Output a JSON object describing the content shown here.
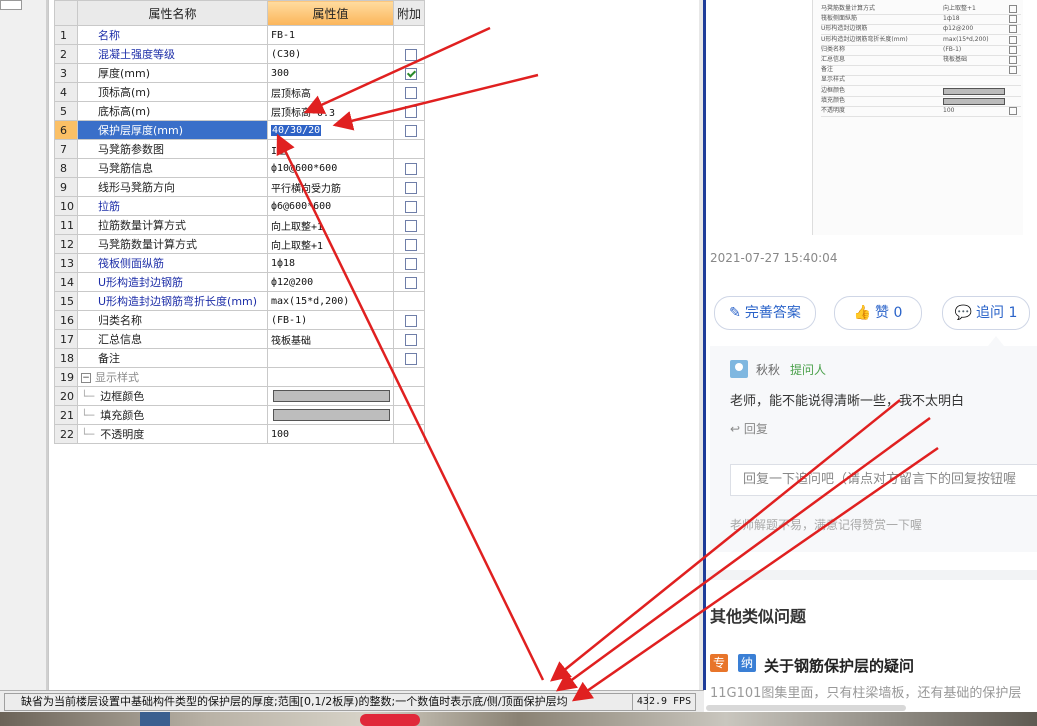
{
  "table": {
    "header_name": "属性名称",
    "header_value": "属性值",
    "header_extra": "附加",
    "rows": [
      {
        "no": "1",
        "name": "名称",
        "value": "FB-1",
        "checkbox": "none"
      },
      {
        "no": "2",
        "name": "混凝土强度等级",
        "value": "(C30)",
        "checkbox": "unchecked"
      },
      {
        "no": "3",
        "name": "厚度(mm)",
        "value": "300",
        "checkbox": "checked"
      },
      {
        "no": "4",
        "name": "顶标高(m)",
        "value": "层顶标高",
        "checkbox": "unchecked"
      },
      {
        "no": "5",
        "name": "底标高(m)",
        "value": "层顶标高-0.3",
        "checkbox": "unchecked"
      },
      {
        "no": "6",
        "name": "保护层厚度(mm)",
        "value": "40/30/20",
        "checkbox": "unchecked"
      },
      {
        "no": "7",
        "name": "马凳筋参数图",
        "value": "I型",
        "checkbox": "none"
      },
      {
        "no": "8",
        "name": "马凳筋信息",
        "value": "ф10@600*600",
        "checkbox": "unchecked"
      },
      {
        "no": "9",
        "name": "线形马凳筋方向",
        "value": "平行横向受力筋",
        "checkbox": "unchecked"
      },
      {
        "no": "10",
        "name": "拉筋",
        "value": "ф6@600*600",
        "checkbox": "unchecked"
      },
      {
        "no": "11",
        "name": "拉筋数量计算方式",
        "value": "向上取整+1",
        "checkbox": "unchecked"
      },
      {
        "no": "12",
        "name": "马凳筋数量计算方式",
        "value": "向上取整+1",
        "checkbox": "unchecked"
      },
      {
        "no": "13",
        "name": "筏板侧面纵筋",
        "value": "1ф18",
        "checkbox": "unchecked"
      },
      {
        "no": "14",
        "name": "U形构造封边钢筋",
        "value": "ф12@200",
        "checkbox": "unchecked"
      },
      {
        "no": "15",
        "name": "U形构造封边钢筋弯折长度(mm)",
        "value": "max(15*d,200)",
        "checkbox": "none"
      },
      {
        "no": "16",
        "name": "归类名称",
        "value": "(FB-1)",
        "checkbox": "unchecked"
      },
      {
        "no": "17",
        "name": "汇总信息",
        "value": "筏板基础",
        "checkbox": "unchecked"
      },
      {
        "no": "18",
        "name": "备注",
        "value": "",
        "checkbox": "unchecked"
      },
      {
        "no": "19",
        "name": "显示样式",
        "value": "",
        "checkbox": "none",
        "group": "−"
      },
      {
        "no": "20",
        "name": "边框颜色",
        "value": "",
        "checkbox": "none",
        "swatch": "#bdbdbd"
      },
      {
        "no": "21",
        "name": "填充颜色",
        "value": "",
        "checkbox": "none",
        "swatch": "#bdbdbd"
      },
      {
        "no": "22",
        "name": "不透明度",
        "value": "100",
        "checkbox": "none"
      }
    ]
  },
  "status": {
    "message": "缺省为当前楼层设置中基础构件类型的保护层的厚度;范围[0,1/2板厚)的整数;一个数值时表示底/侧/顶面保护层均",
    "fps": "432.9 FPS"
  },
  "right": {
    "timestamp": "2021-07-27 15:40:04",
    "buttons": {
      "improve": "完善答案",
      "like": "赞 0",
      "followup": "追问 1"
    },
    "comment": {
      "user": "秋秋",
      "role": "提问人",
      "text": "老师，能不能说得清晰一些，我不太明白",
      "reply": "回复",
      "reply_placeholder": "回复一下追问吧（请点对方留言下的回复按钮喔",
      "hint": "老师解题不易，满意记得赞赏一下喔"
    },
    "similar_title": "其他类似问题",
    "tags": [
      "专",
      "纳"
    ],
    "question_title": "关于钢筋保护层的疑问",
    "question_desc": "11G101图集里面，只有柱梁墙板，还有基础的保护层"
  },
  "thumbnail_rows": [
    {
      "label": "马凳筋数量计算方式",
      "value": "向上取整+1"
    },
    {
      "label": "筏板侧面纵筋",
      "value": "1ф18"
    },
    {
      "label": "U形构造封边钢筋",
      "value": "ф12@200"
    },
    {
      "label": "U形构造封边钢筋弯折长度(mm)",
      "value": "max(15*d,200)"
    },
    {
      "label": "归类名称",
      "value": "(FB-1)"
    },
    {
      "label": "汇总信息",
      "value": "筏板基础"
    },
    {
      "label": "备注",
      "value": ""
    },
    {
      "label": "显示样式",
      "value": ""
    },
    {
      "label": "边框颜色",
      "value": ""
    },
    {
      "label": "填充颜色",
      "value": ""
    },
    {
      "label": "不透明度",
      "value": "100"
    }
  ],
  "colors": {
    "annotation": "#e02020",
    "accent": "#2a63c9",
    "selected_row": "#3a6fc9"
  }
}
